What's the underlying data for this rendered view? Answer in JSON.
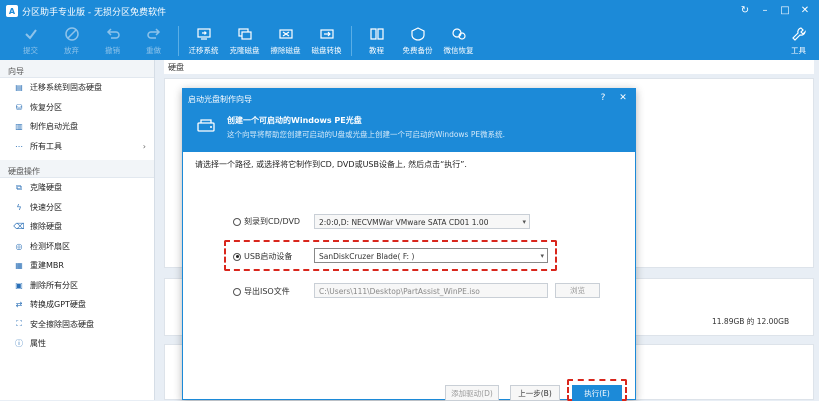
{
  "titlebar": {
    "title": "分区助手专业版 - 无损分区免费软件",
    "controls": [
      "↻",
      "–",
      "□",
      "✕"
    ]
  },
  "toolbar": {
    "left_buttons": [
      {
        "label": "提交",
        "icon": "check-icon",
        "disabled": true
      },
      {
        "label": "放弃",
        "icon": "cancel-icon",
        "disabled": true
      },
      {
        "label": "撤销",
        "icon": "undo-icon",
        "disabled": true
      },
      {
        "label": "重做",
        "icon": "redo-icon",
        "disabled": true
      }
    ],
    "right_buttons": [
      {
        "label": "迁移系统",
        "icon": "migrate-icon"
      },
      {
        "label": "克隆磁盘",
        "icon": "clone-disk-icon"
      },
      {
        "label": "擦除磁盘",
        "icon": "wipe-disk-icon"
      },
      {
        "label": "磁盘转换",
        "icon": "convert-disk-icon"
      },
      {
        "label": "教程",
        "icon": "book-icon"
      },
      {
        "label": "免费备份",
        "icon": "backup-icon"
      },
      {
        "label": "微信恢复",
        "icon": "recover-icon"
      }
    ],
    "tools_label": "工具"
  },
  "sidebar": {
    "wizard_section": "向导",
    "wizard_items": [
      {
        "label": "迁移系统到固态硬盘",
        "icon": "migrate-icon"
      },
      {
        "label": "恢复分区",
        "icon": "restore-icon"
      },
      {
        "label": "制作启动光盘",
        "icon": "disc-icon"
      },
      {
        "label": "所有工具",
        "icon": "more-icon",
        "chevron": "›"
      }
    ],
    "disk_section": "硬盘操作",
    "disk_items": [
      {
        "label": "克隆硬盘",
        "icon": "clone-icon"
      },
      {
        "label": "快速分区",
        "icon": "lightning-icon"
      },
      {
        "label": "擦除硬盘",
        "icon": "wipe-icon"
      },
      {
        "label": "检测坏扇区",
        "icon": "scan-icon"
      },
      {
        "label": "重建MBR",
        "icon": "rebuild-icon"
      },
      {
        "label": "删除所有分区",
        "icon": "delete-icon"
      },
      {
        "label": "转换成GPT硬盘",
        "icon": "convert-icon"
      },
      {
        "label": "安全擦除固态硬盘",
        "icon": "ssd-icon"
      },
      {
        "label": "属性",
        "icon": "info-icon"
      }
    ]
  },
  "main": {
    "disk_header": "硬盘",
    "right_panel_value": "11.89GB 的 12.00GB"
  },
  "dialog": {
    "title": "启动光盘制作向导",
    "help": "?",
    "close": "✕",
    "banner_title": "创建一个可启动的Windows PE光盘",
    "banner_subtitle": "这个向导将帮助您创建可启动的U盘或光盘上创建一个可启动的Windows PE微系统.",
    "instruction": "请选择一个路径, 或选择将它制作到CD, DVD或USB设备上, 然后点击“执行”.",
    "options": [
      {
        "label": "刻录到CD/DVD",
        "value": "2:0:0,D: NECVMWar VMware SATA CD01 1.00",
        "selected": false
      },
      {
        "label": "USB启动设备",
        "value": "SanDiskCruzer Blade( F: )",
        "selected": true
      },
      {
        "label": "导出ISO文件",
        "value": "C:\\Users\\111\\Desktop\\PartAssist_WinPE.iso",
        "selected": false
      }
    ],
    "browse_label": "浏览",
    "buttons": {
      "add_driver": "添加驱动(D)",
      "back": "上一步(B)",
      "execute": "执行(E)"
    }
  },
  "colors": {
    "accent": "#1c8ad8",
    "highlight": "#d9261c"
  }
}
